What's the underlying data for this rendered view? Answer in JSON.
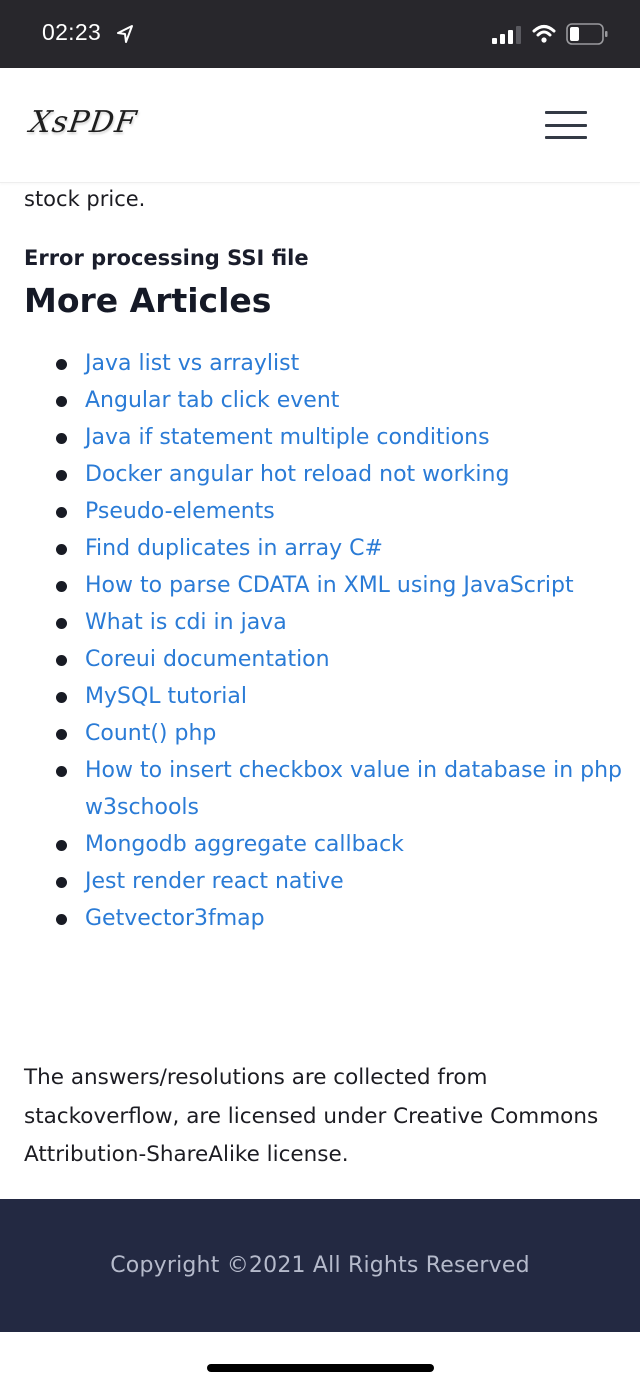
{
  "status_bar": {
    "time": "02:23",
    "icons": [
      "location-arrow-icon",
      "cellular-signal-icon",
      "wifi-icon",
      "battery-icon"
    ],
    "signal_bars_active": 3,
    "signal_bars_total": 4,
    "battery_level": 0.25
  },
  "navbar": {
    "logo": "XsPDF",
    "menu_icon": "hamburger-menu-icon"
  },
  "content": {
    "intro_tail": "stock price.",
    "error_line": "Error processing SSI file",
    "more_title": "More Articles",
    "articles": [
      {
        "label": "Java list vs arraylist"
      },
      {
        "label": "Angular tab click event"
      },
      {
        "label": "Java if statement multiple conditions"
      },
      {
        "label": "Docker angular hot reload not working"
      },
      {
        "label": "Pseudo-elements"
      },
      {
        "label": "Find duplicates in array C#"
      },
      {
        "label": "How to parse CDATA in XML using JavaScript"
      },
      {
        "label": "What is cdi in java"
      },
      {
        "label": "Coreui documentation"
      },
      {
        "label": "MySQL tutorial"
      },
      {
        "label": "Count() php"
      },
      {
        "label": "How to insert checkbox value in database in php w3schools"
      },
      {
        "label": "Mongodb aggregate callback"
      },
      {
        "label": "Jest render react native"
      },
      {
        "label": "Getvector3fmap"
      }
    ],
    "license_text": "The answers/resolutions are collected from stackoverflow, are licensed under Creative Commons Attribution-ShareAlike license."
  },
  "footer": {
    "copyright": "Copyright ©2021 All Rights Reserved"
  },
  "colors": {
    "status_bar_bg": "#28272c",
    "link": "#2a7bd6",
    "footer_bg": "#232942",
    "footer_text": "#b5bacb",
    "heading": "#151926"
  }
}
